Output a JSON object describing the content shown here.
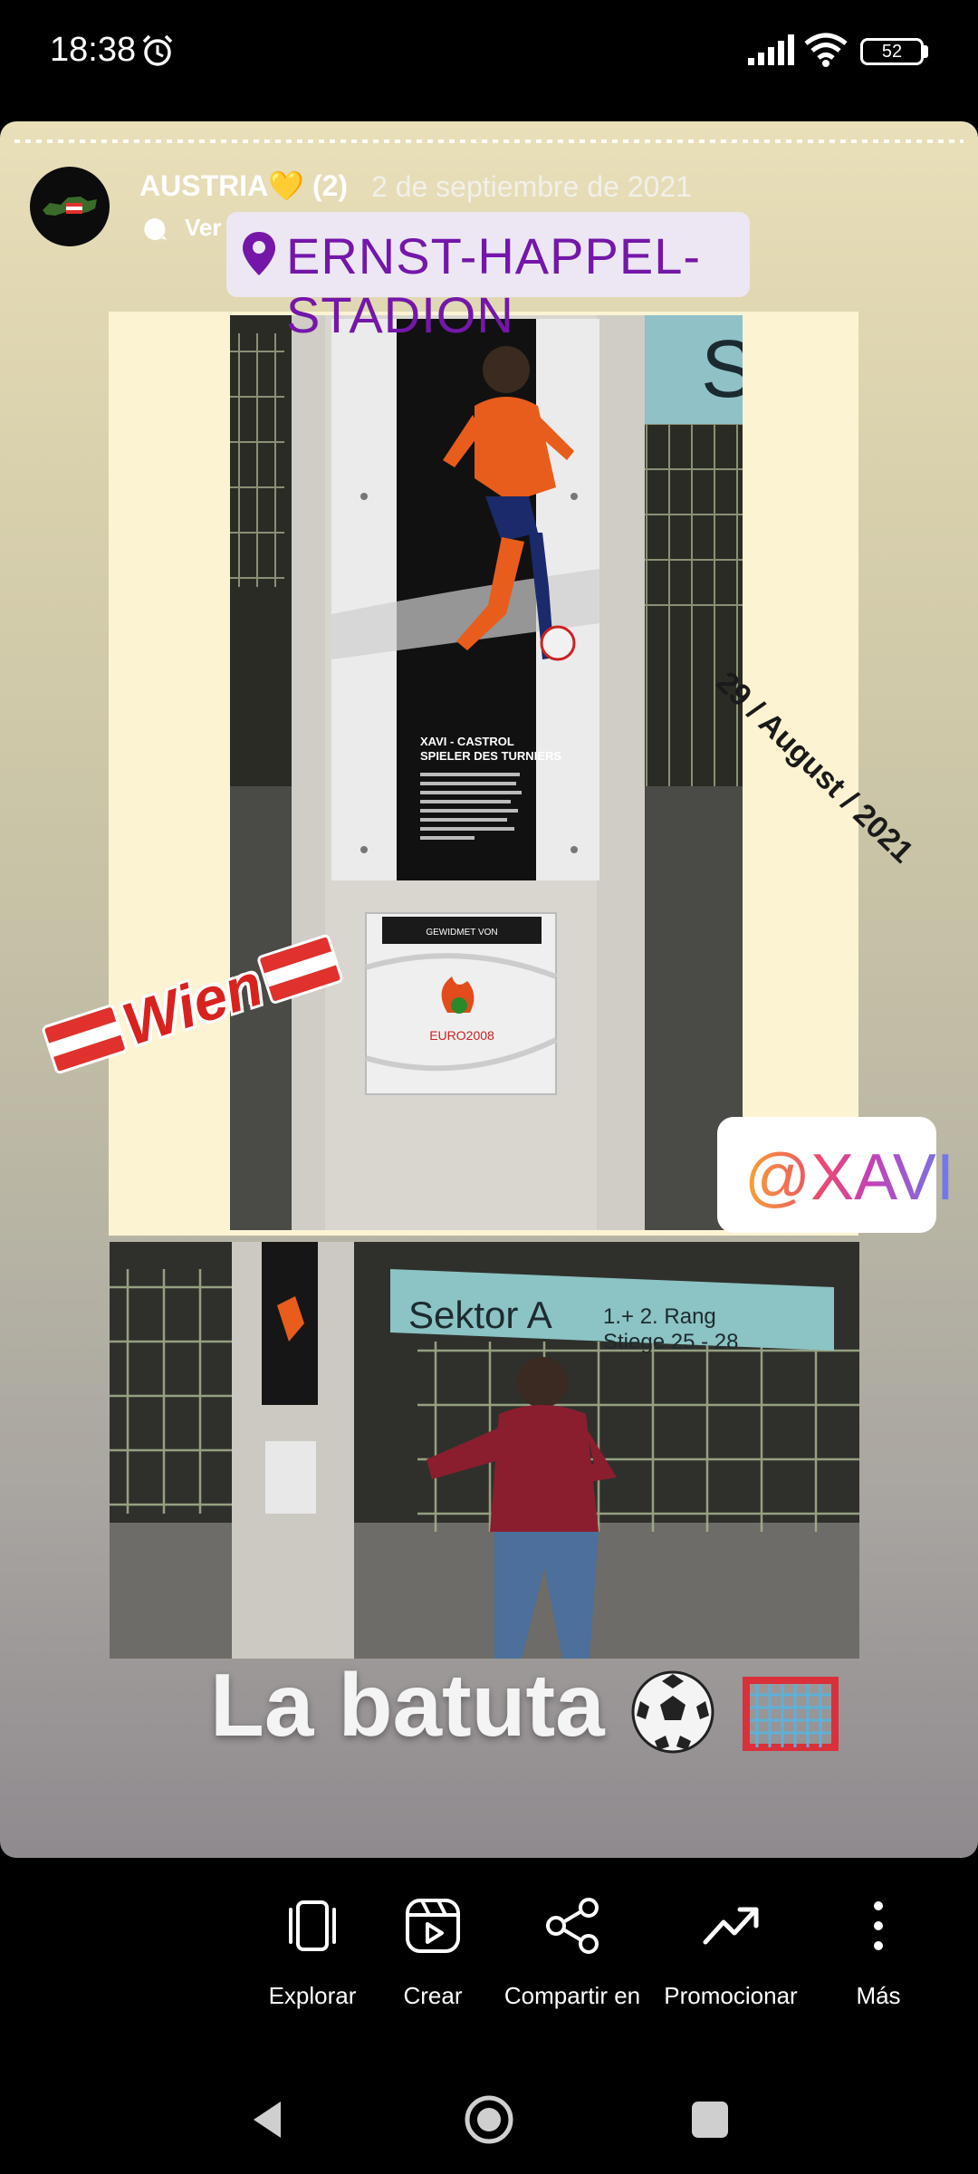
{
  "status_bar": {
    "time": "18:38",
    "battery": "52",
    "icons": [
      "alarm-icon",
      "signal-icon",
      "wifi-icon",
      "battery-icon"
    ]
  },
  "story": {
    "author": "AUSTRIA💛 (2)",
    "date": "2 de septiembre de 2021",
    "translate": "Ver traducción",
    "location": "ERNST-HAPPEL-STADION",
    "date_sticker": "29 / August / 2021",
    "wien": "Wien",
    "mention": "@XAVI",
    "caption": "La batuta",
    "plaque": {
      "title_line1": "XAVI - CASTROL",
      "title_line2": "SPIELER DES TURNIERS",
      "dedication": "GEWIDMET VON",
      "logo_text": "EURO2008"
    },
    "photo2_signs": {
      "sektor": "Sektor A",
      "rang": "1.+ 2. Rang",
      "stiege": "Stiege 25 - 28"
    }
  },
  "actions": [
    {
      "label": "Explorar",
      "icon": "explore-icon"
    },
    {
      "label": "Crear",
      "icon": "create-reel-icon"
    },
    {
      "label": "Compartir en",
      "icon": "share-icon"
    },
    {
      "label": "Promocionar",
      "icon": "promote-icon"
    },
    {
      "label": "Más",
      "icon": "more-icon"
    }
  ],
  "colors": {
    "location_text": "#7417a9",
    "wien_text": "#d8221e",
    "austria_red": "#e0312d"
  }
}
